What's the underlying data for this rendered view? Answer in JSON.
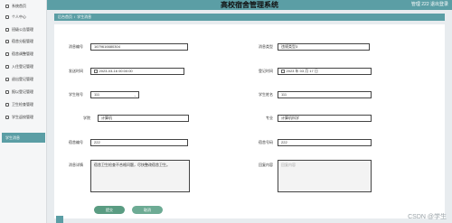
{
  "header": {
    "title": "高校宿舍管理系统",
    "user": "管理 222 退出登录"
  },
  "sidebar": {
    "items": [
      {
        "label": "系统首页",
        "active": false
      },
      {
        "label": "个人中心",
        "active": false
      },
      {
        "label": "班级公告管理",
        "active": false
      },
      {
        "label": "宿舍分配管理",
        "active": false
      },
      {
        "label": "宿舍调整管理",
        "active": false
      },
      {
        "label": "入住登记管理",
        "active": false
      },
      {
        "label": "退出登记管理",
        "active": false
      },
      {
        "label": "报以登记管理",
        "active": false
      },
      {
        "label": "卫生检查管理",
        "active": false
      },
      {
        "label": "学生返校管理",
        "active": false
      },
      {
        "label": "学生消息",
        "active": true
      }
    ]
  },
  "breadcrumb": {
    "home": "后台首页",
    "separator": "/",
    "current": "学生消息"
  },
  "form": {
    "order_no": {
      "label": "消息编号",
      "value": "1679616680304"
    },
    "msg_type": {
      "label": "消息类型",
      "value": "违规类型3"
    },
    "send_time": {
      "label": "发送时间",
      "value": "2023-03-16 00:00:00"
    },
    "reg_time": {
      "label": "登记时间",
      "value": "2023 年 03 月 17 日"
    },
    "student_no": {
      "label": "学生账号",
      "value": "111"
    },
    "student_name": {
      "label": "学生姓名",
      "value": "111"
    },
    "college": {
      "label": "学院",
      "value": "计算机"
    },
    "major": {
      "label": "专业",
      "value": "计算机科学"
    },
    "dorm_no": {
      "label": "宿舍编号",
      "value": "222"
    },
    "room_no": {
      "label": "宿舍号码",
      "value": "222"
    },
    "content": {
      "label": "消息详情",
      "value": "宿舍卫生检查不合格问题，尽快整改宿舍卫生。"
    },
    "reply": {
      "label": "回复内容",
      "placeholder": "回复内容"
    }
  },
  "buttons": {
    "submit": "提交",
    "cancel": "取消"
  },
  "watermark": "CSDN @学生",
  "colors": {
    "accent": "#5b9ea5",
    "button": "#5a9c82"
  }
}
